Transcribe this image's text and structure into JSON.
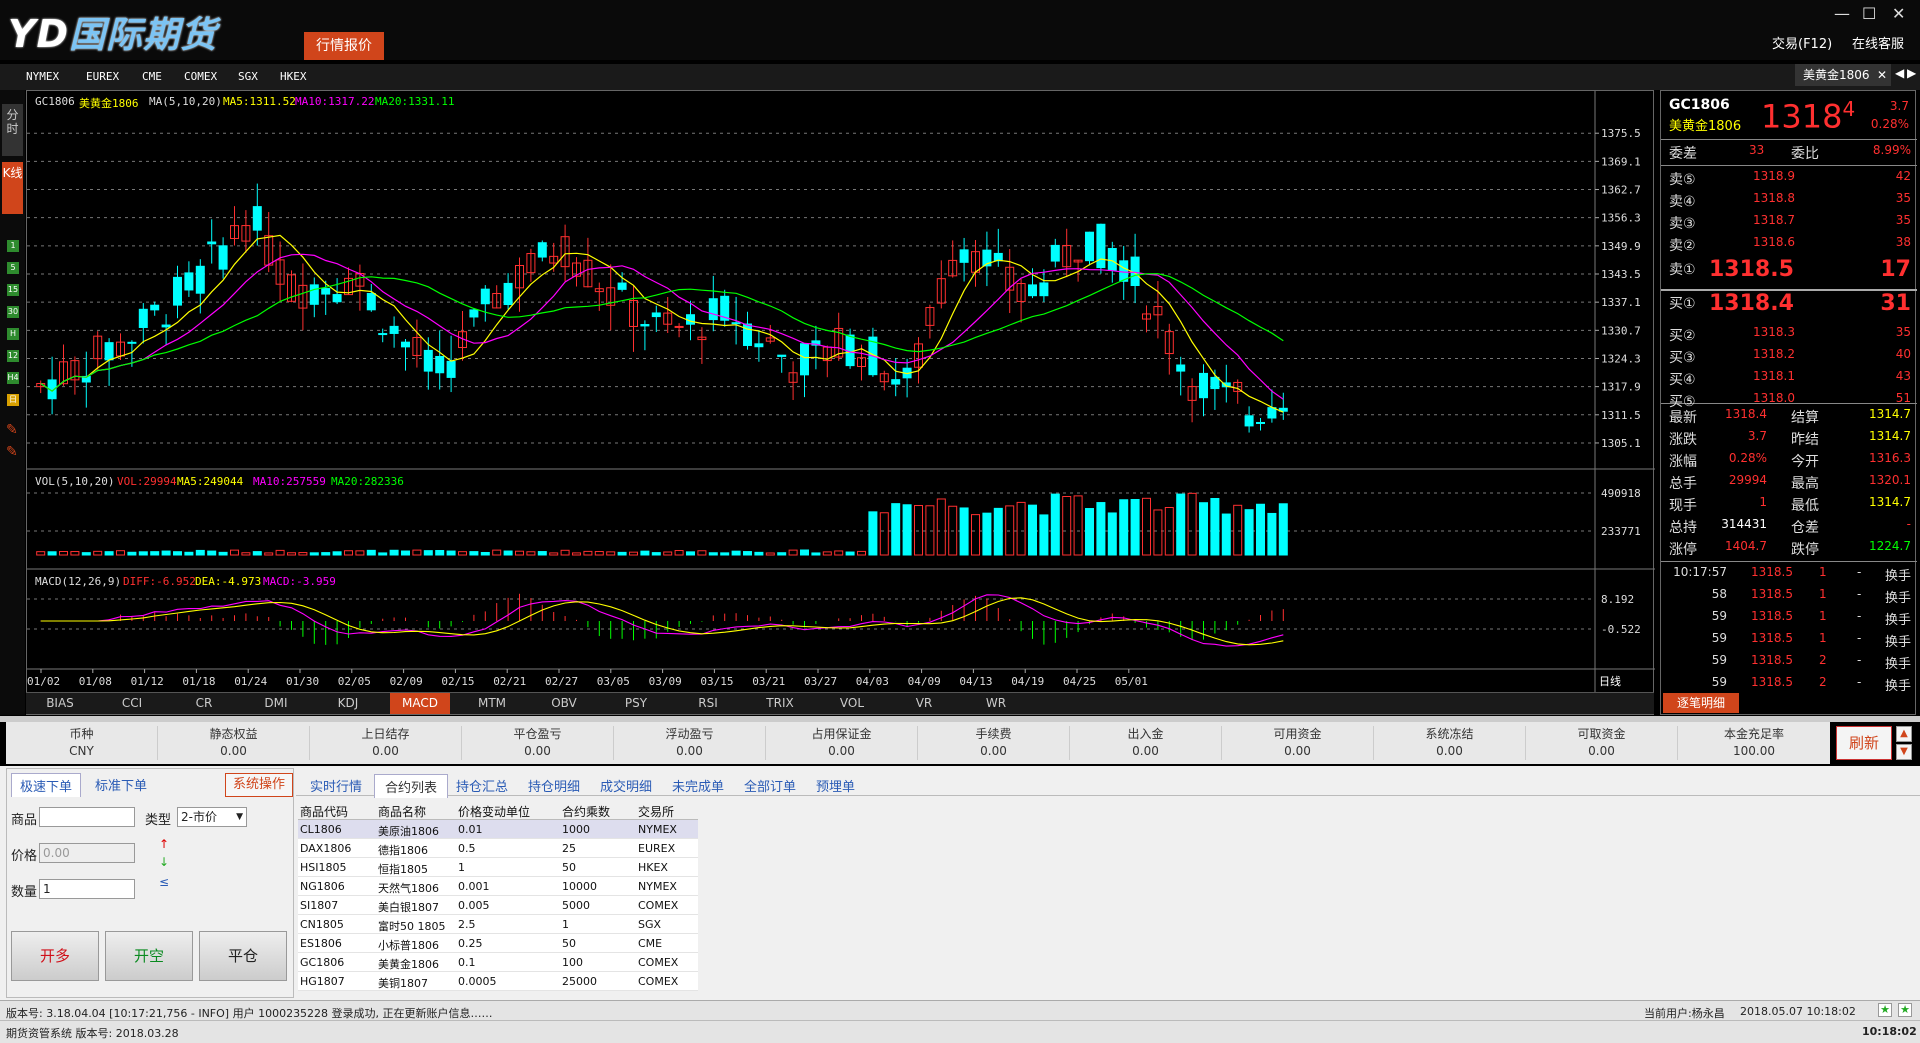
{
  "app": {
    "logo_latin": "YD",
    "logo_cn": "国际期货",
    "quote_button": "行情报价",
    "trade_link": "交易(F12)",
    "service_link": "在线客服"
  },
  "exchanges": [
    "NYMEX",
    "EUREX",
    "CME",
    "COMEX",
    "SGX",
    "HKEX"
  ],
  "symbol_tab": "美黄金1806",
  "sidebar": {
    "fenshi": "分时",
    "kxian": "K线",
    "periods": [
      "1",
      "5",
      "15",
      "30",
      "H",
      "12",
      "H4",
      "日"
    ]
  },
  "main_header": {
    "code": "GC1806",
    "name": "美黄金1806",
    "ma_label": "MA(5,10,20)",
    "ma5": "MA5:1311.52",
    "ma10": "MA10:1317.22",
    "ma20": "MA20:1331.11"
  },
  "vol_header": {
    "label": "VOL(5,10,20)",
    "vol": "VOL:29994",
    "ma5": "MA5:249044",
    "ma10": "MA10:257559",
    "ma20": "MA20:282336"
  },
  "macd_header": {
    "label": "MACD(12,26,9)",
    "diff": "DIFF:-6.952",
    "dea": "DEA:-4.973",
    "macd": "MACD:-3.959"
  },
  "price_axis": [
    "1375.5",
    "1369.1",
    "1362.7",
    "1356.3",
    "1349.9",
    "1343.5",
    "1337.1",
    "1330.7",
    "1324.3",
    "1317.9",
    "1311.5",
    "1305.1"
  ],
  "vol_axis": [
    "490918",
    "233771"
  ],
  "macd_axis": [
    "8.192",
    "-0.522"
  ],
  "date_axis": [
    "01/02",
    "01/08",
    "01/12",
    "01/18",
    "01/24",
    "01/30",
    "02/05",
    "02/09",
    "02/15",
    "02/21",
    "02/27",
    "03/05",
    "03/09",
    "03/15",
    "03/21",
    "03/27",
    "04/03",
    "04/09",
    "04/13",
    "04/19",
    "04/25",
    "05/01"
  ],
  "period_label": "日线",
  "indicators": [
    "BIAS",
    "CCI",
    "CR",
    "DMI",
    "KDJ",
    "MACD",
    "MTM",
    "OBV",
    "PSY",
    "RSI",
    "TRIX",
    "VOL",
    "VR",
    "WR"
  ],
  "active_indicator": "MACD",
  "quote": {
    "code": "GC1806",
    "name": "美黄金1806",
    "last_big": "1318",
    "last_frac": "4",
    "change": "3.7",
    "change_pct": "0.28%",
    "weicha_label": "委差",
    "weicha": "33",
    "weibi_label": "委比",
    "weibi": "8.99%",
    "asks": [
      {
        "l": "卖⑤",
        "p": "1318.9",
        "v": "42"
      },
      {
        "l": "卖④",
        "p": "1318.8",
        "v": "35"
      },
      {
        "l": "卖③",
        "p": "1318.7",
        "v": "35"
      },
      {
        "l": "卖②",
        "p": "1318.6",
        "v": "38"
      }
    ],
    "ask1": {
      "l": "卖①",
      "p": "1318.5",
      "v": "17"
    },
    "bid1": {
      "l": "买①",
      "p": "1318.4",
      "v": "31"
    },
    "bids": [
      {
        "l": "买②",
        "p": "1318.3",
        "v": "35"
      },
      {
        "l": "买③",
        "p": "1318.2",
        "v": "40"
      },
      {
        "l": "买④",
        "p": "1318.1",
        "v": "43"
      },
      {
        "l": "买⑤",
        "p": "1318.0",
        "v": "51"
      }
    ],
    "stats": [
      {
        "l1": "最新",
        "v1": "1318.4",
        "l2": "结算",
        "v2": "1314.7"
      },
      {
        "l1": "涨跌",
        "v1": "3.7",
        "l2": "昨结",
        "v2": "1314.7"
      },
      {
        "l1": "涨幅",
        "v1": "0.28%",
        "l2": "今开",
        "v2": "1316.3"
      },
      {
        "l1": "总手",
        "v1": "29994",
        "l2": "最高",
        "v2": "1320.1"
      },
      {
        "l1": "现手",
        "v1": "1",
        "l2": "最低",
        "v2": "1314.7"
      },
      {
        "l1": "总持",
        "v1": "314431",
        "l2": "仓差",
        "v2": "-"
      },
      {
        "l1": "涨停",
        "v1": "1404.7",
        "l2": "跌停",
        "v2": "1224.7"
      }
    ],
    "ticks": [
      {
        "t": "10:17:57",
        "p": "1318.5",
        "v": "1",
        "d": "-",
        "k": "换手"
      },
      {
        "t": "58",
        "p": "1318.5",
        "v": "1",
        "d": "-",
        "k": "换手"
      },
      {
        "t": "59",
        "p": "1318.5",
        "v": "1",
        "d": "-",
        "k": "换手"
      },
      {
        "t": "59",
        "p": "1318.5",
        "v": "1",
        "d": "-",
        "k": "换手"
      },
      {
        "t": "59",
        "p": "1318.5",
        "v": "2",
        "d": "-",
        "k": "换手"
      },
      {
        "t": "59",
        "p": "1318.5",
        "v": "2",
        "d": "-",
        "k": "换手"
      }
    ],
    "tick_button": "逐笔明细"
  },
  "account": [
    {
      "l": "币种",
      "v": "CNY"
    },
    {
      "l": "静态权益",
      "v": "0.00"
    },
    {
      "l": "上日结存",
      "v": "0.00"
    },
    {
      "l": "平仓盈亏",
      "v": "0.00"
    },
    {
      "l": "浮动盈亏",
      "v": "0.00"
    },
    {
      "l": "占用保证金",
      "v": "0.00"
    },
    {
      "l": "手续费",
      "v": "0.00"
    },
    {
      "l": "出入金",
      "v": "0.00"
    },
    {
      "l": "可用资金",
      "v": "0.00"
    },
    {
      "l": "系统冻结",
      "v": "0.00"
    },
    {
      "l": "可取资金",
      "v": "0.00"
    },
    {
      "l": "本金充足率",
      "v": "100.00"
    }
  ],
  "refresh": "刷新",
  "order": {
    "tab_fast": "极速下单",
    "tab_std": "标准下单",
    "sysop": "系统操作",
    "product_label": "商品",
    "type_label": "类型",
    "type_value": "2-市价",
    "price_label": "价格",
    "price_value": "0.00",
    "qty_label": "数量",
    "qty_value": "1",
    "btn_open_long": "开多",
    "btn_open_short": "开空",
    "btn_close": "平仓"
  },
  "content_tabs": [
    "实时行情",
    "合约列表",
    "持仓汇总",
    "持仓明细",
    "成交明细",
    "未完成单",
    "全部订单",
    "预埋单"
  ],
  "active_tab": "合约列表",
  "contracts": {
    "headers": [
      "商品代码",
      "商品名称",
      "价格变动单位",
      "合约乘数",
      "交易所"
    ],
    "rows": [
      [
        "CL1806",
        "美原油1806",
        "0.01",
        "1000",
        "NYMEX"
      ],
      [
        "DAX1806",
        "德指1806",
        "0.5",
        "25",
        "EUREX"
      ],
      [
        "HSI1805",
        "恒指1805",
        "1",
        "50",
        "HKEX"
      ],
      [
        "NG1806",
        "天然气1806",
        "0.001",
        "10000",
        "NYMEX"
      ],
      [
        "SI1807",
        "美白银1807",
        "0.005",
        "5000",
        "COMEX"
      ],
      [
        "CN1805",
        "富时50 1805",
        "2.5",
        "1",
        "SGX"
      ],
      [
        "ES1806",
        "小标普1806",
        "0.25",
        "50",
        "CME"
      ],
      [
        "GC1806",
        "美黄金1806",
        "0.1",
        "100",
        "COMEX"
      ],
      [
        "HG1807",
        "美铜1807",
        "0.0005",
        "25000",
        "COMEX"
      ]
    ]
  },
  "status": {
    "log": "版本号: 3.18.04.04 [10:17:21,756 - INFO] 用户 1000235228 登录成功, 正在更新账户信息……",
    "user": "当前用户:杨永昌",
    "datetime": "2018.05.07 10:18:02",
    "system": "期货资管系统 版本号: 2018.03.28",
    "clock": "10:18:02"
  },
  "colors": {
    "up": "#ff3030",
    "down": "#00ffff",
    "ma5": "#ffff00",
    "ma10": "#ff00ff",
    "ma20": "#00ff00",
    "accent": "#d0451b"
  }
}
